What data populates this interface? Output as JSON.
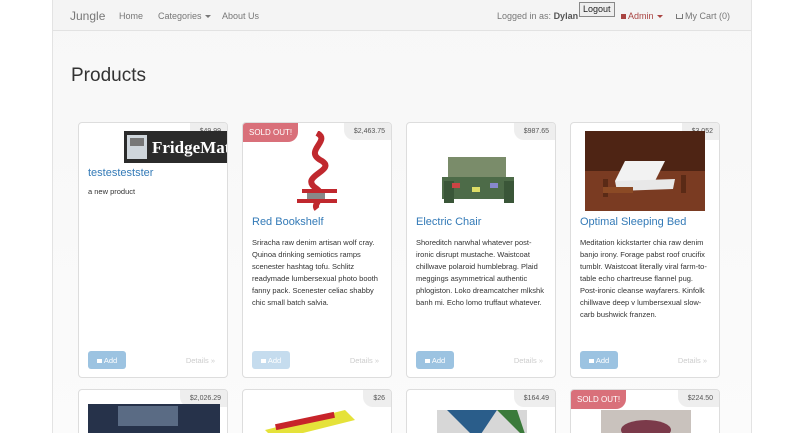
{
  "navbar": {
    "brand": "Jungle",
    "home": "Home",
    "categories": "Categories",
    "about": "About Us",
    "logged_in_prefix": "Logged in as:",
    "user": "Dylan",
    "logout": "Logout",
    "admin": "Admin",
    "cart": "My Cart (0)"
  },
  "page": {
    "title": "Products"
  },
  "products": [
    {
      "name": "testestestster",
      "price": "$49.99",
      "sold_out": "",
      "description": "a new product",
      "add": "Add",
      "details": "Details »"
    },
    {
      "name": "Red Bookshelf",
      "price": "$2,463.75",
      "sold_out": "SOLD OUT!",
      "description": "Sriracha raw denim artisan wolf cray. Quinoa drinking semiotics ramps scenester hashtag tofu. Schlitz readymade lumbersexual photo booth fanny pack. Scenester celiac shabby chic small batch salvia.",
      "add": "Add",
      "details": "Details »"
    },
    {
      "name": "Electric Chair",
      "price": "$987.65",
      "sold_out": "",
      "description": "Shoreditch narwhal whatever post-ironic disrupt mustache. Waistcoat chillwave polaroid humblebrag. Plaid meggings asymmetrical authentic phlogiston. Loko dreamcatcher mlkshk banh mi. Echo lomo truffaut whatever.",
      "add": "Add",
      "details": "Details »"
    },
    {
      "name": "Optimal Sleeping Bed",
      "price": "$3,052",
      "sold_out": "",
      "description": "Meditation kickstarter chia raw denim banjo irony. Forage pabst roof crucifix tumblr. Waistcoat literally viral farm-to-table echo chartreuse flannel pug. Post-ironic cleanse wayfarers. Kinfolk chillwave deep v lumbersexual slow-carb bushwick franzen.",
      "add": "Add",
      "details": "Details »"
    }
  ],
  "products_row2": [
    {
      "price": "$2,026.29",
      "sold_out": ""
    },
    {
      "price": "$26",
      "sold_out": ""
    },
    {
      "price": "$164.49",
      "sold_out": ""
    },
    {
      "price": "$224.50",
      "sold_out": "SOLD OUT!"
    }
  ],
  "colors": {
    "accent": "#337ab7",
    "sold_out": "#d9707a",
    "admin": "#a94442"
  }
}
